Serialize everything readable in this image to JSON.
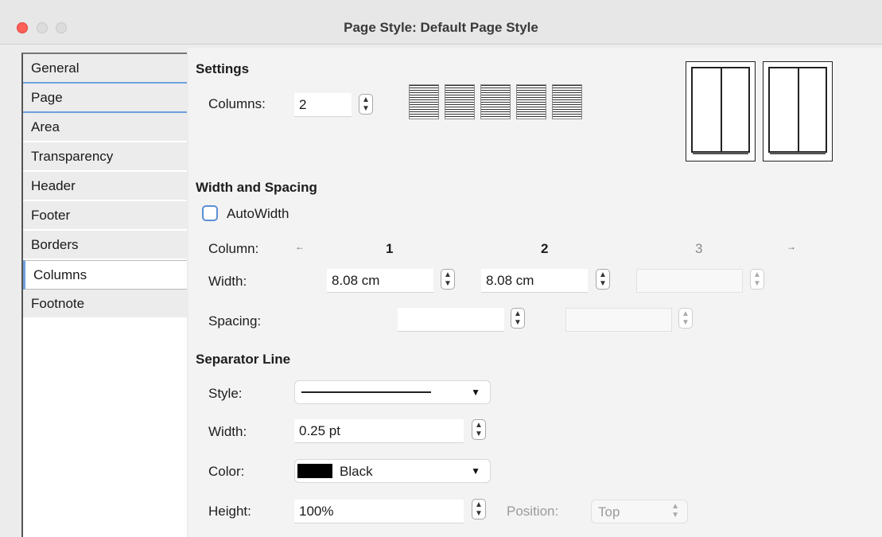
{
  "window": {
    "title": "Page Style: Default Page Style"
  },
  "sidebar": {
    "tabs": [
      {
        "label": "General"
      },
      {
        "label": "Page"
      },
      {
        "label": "Area"
      },
      {
        "label": "Transparency"
      },
      {
        "label": "Header"
      },
      {
        "label": "Footer"
      },
      {
        "label": "Borders"
      },
      {
        "label": "Columns"
      },
      {
        "label": "Footnote"
      }
    ],
    "active": "Columns"
  },
  "settings": {
    "title": "Settings",
    "columns_label": "Columns:",
    "columns_value": "2"
  },
  "width_spacing": {
    "title": "Width and Spacing",
    "autowidth_label": "AutoWidth",
    "autowidth_checked": false,
    "column_label": "Column:",
    "col_numbers": [
      "1",
      "2",
      "3"
    ],
    "width_label": "Width:",
    "widths": [
      "8.08 cm",
      "8.08 cm",
      ""
    ],
    "spacing_label": "Spacing:",
    "spacings": [
      "",
      ""
    ]
  },
  "separator": {
    "title": "Separator Line",
    "style_label": "Style:",
    "width_label": "Width:",
    "width_value": "0.25 pt",
    "color_label": "Color:",
    "color_value": "Black",
    "color_swatch": "#000000",
    "height_label": "Height:",
    "height_value": "100%",
    "position_label": "Position:",
    "position_value": "Top"
  },
  "icons": {
    "spin": "stepper-icon",
    "arrow_left": "arrow-left-icon",
    "arrow_right": "arrow-right-icon",
    "dropdown": "chevron-down-icon"
  },
  "colors": {
    "accent": "#6fa0dc",
    "close": "#fe5f57"
  }
}
